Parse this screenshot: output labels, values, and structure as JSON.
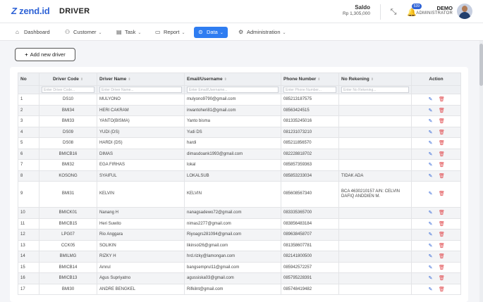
{
  "app": {
    "logo_mark": "Z",
    "logo_text": "zend.id",
    "page_title": "DRIVER"
  },
  "topbar": {
    "saldo_label": "Saldo",
    "saldo_value": "Rp 1,305,000",
    "notification_count": "539",
    "user_name": "DEMO",
    "user_role": "ADMINISTRATOR"
  },
  "nav": {
    "items": [
      {
        "label": "Dashboard",
        "icon": "home-icon"
      },
      {
        "label": "Customer",
        "icon": "users-icon"
      },
      {
        "label": "Task",
        "icon": "document-icon"
      },
      {
        "label": "Report",
        "icon": "folder-icon"
      },
      {
        "label": "Data",
        "icon": "database-icon"
      },
      {
        "label": "Administration",
        "icon": "gear-icon"
      }
    ],
    "active": "Data"
  },
  "toolbar": {
    "add_label": "Add new driver"
  },
  "table": {
    "headers": {
      "no": "No",
      "code": "Driver Code",
      "name": "Driver Name",
      "email": "Email/Username",
      "phone": "Phone Number",
      "rek": "No Rekening",
      "action": "Action"
    },
    "placeholders": {
      "code": "Enter Driver Code...",
      "name": "Enter Driver Name...",
      "email": "Enter Email/Username...",
      "phone": "Enter Phone Number...",
      "rek": "Enter No Rekening..."
    },
    "rows": [
      {
        "no": "1",
        "code": "DS10",
        "name": "MULYONO",
        "email": "mulyono9790@gmail.com",
        "phone": "085213187575",
        "rek": ""
      },
      {
        "no": "2",
        "code": "BMI34",
        "name": "HERI CAKRAM",
        "email": "irwantoheri81@gmail.com",
        "phone": "08563424515",
        "rek": ""
      },
      {
        "no": "3",
        "code": "BMI33",
        "name": "YANTO(BISMA)",
        "email": "Yanto bisma",
        "phone": "081335245016",
        "rek": ""
      },
      {
        "no": "4",
        "code": "DS09",
        "name": "YUDI (DS)",
        "email": "Yudi DS",
        "phone": "081231073210",
        "rek": ""
      },
      {
        "no": "5",
        "code": "DS08",
        "name": "HARDI (DS)",
        "email": "hardi",
        "phone": "085211856570",
        "rek": ""
      },
      {
        "no": "6",
        "code": "BMICB16",
        "name": "DIMAS",
        "email": "dimasdoank1993@gmail.com",
        "phone": "082228818702",
        "rek": ""
      },
      {
        "no": "7",
        "code": "BMI32",
        "name": "EGA FIRHAS",
        "email": "lokal",
        "phone": "085857359363",
        "rek": ""
      },
      {
        "no": "8",
        "code": "KOSONG",
        "name": "SYAIFUL",
        "email": "LOKALSUB",
        "phone": "085853233034",
        "rek": "TIDAK ADA"
      },
      {
        "no": "9",
        "code": "BMI31",
        "name": "KELVIN",
        "email": "KELVIN",
        "phone": "085608567340",
        "rek": "BCA 4630210157 A/N: CELVIN DAFIQ ANDDIEN M."
      },
      {
        "no": "10",
        "code": "BMICK01",
        "name": "Nanang H",
        "email": "nanagsadewo72@gmail.com",
        "phone": "083335365700",
        "rek": ""
      },
      {
        "no": "11",
        "code": "BMICB15",
        "name": "Heri Suwito",
        "email": "nimas2277@gmail.com",
        "phone": "083856483184",
        "rek": ""
      },
      {
        "no": "12",
        "code": "LPG07",
        "name": "Rio Anggara",
        "email": "Riyoagrs281094@gmail.com",
        "phone": "089638458707",
        "rek": ""
      },
      {
        "no": "13",
        "code": "CCK05",
        "name": "SOLIKIN",
        "email": "likinsol26@gmail.com",
        "phone": "081358607781",
        "rek": ""
      },
      {
        "no": "14",
        "code": "BMILMG",
        "name": "RIZKY H",
        "email": "hrd.rizky@lamongan.com",
        "phone": "082141800500",
        "rek": ""
      },
      {
        "no": "15",
        "code": "BMICB14",
        "name": "Amrul",
        "email": "bangsemprul11@gmail.com",
        "phone": "085942572257",
        "rek": ""
      },
      {
        "no": "16",
        "code": "BMICB13",
        "name": "Agus Supriyatno",
        "email": "agussiska03@gmail.com",
        "phone": "085795228391",
        "rek": ""
      },
      {
        "no": "17",
        "code": "BMI30",
        "name": "ANDRE BENGKEL",
        "email": "Rifkilnt@gmail.com",
        "phone": "085748419482",
        "rek": ""
      }
    ]
  },
  "colors": {
    "accent": "#2f7df1",
    "brand": "#2f63d6",
    "delete": "#e0464a"
  }
}
